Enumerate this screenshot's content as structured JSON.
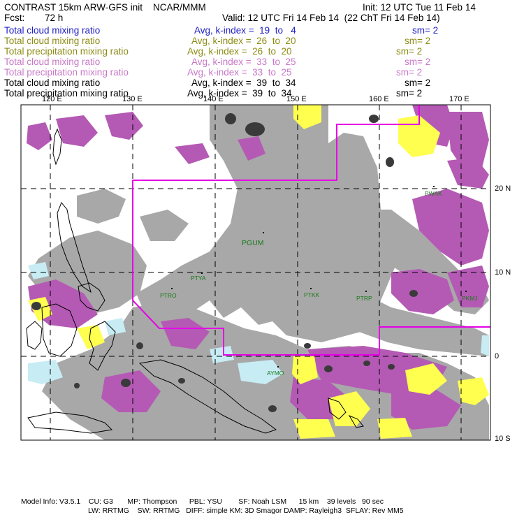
{
  "header": {
    "title": "CONTRAST 15km ARW-GFS init    NCAR/MMM",
    "init": "Init: 12 UTC Tue 11 Feb 14",
    "fcst_label": "Fcst:",
    "fcst_value": "72 h",
    "valid": "Valid: 12 UTC Fri 14 Feb 14  (22 ChT Fri 14 Feb 14)"
  },
  "legend": [
    {
      "name": "Total cloud mixing ratio",
      "avg": "Avg, k-index =  19  to   4",
      "sm": "sm= 2",
      "color": "#2020c8"
    },
    {
      "name": "Total cloud mixing ratio",
      "avg": "Avg, k-index =  26  to  20",
      "sm": "sm= 2",
      "color": "#8c8c14"
    },
    {
      "name": "Total precipitation mixing ratio",
      "avg": "Avg, k-index =  26  to  20",
      "sm": "sm= 2",
      "color": "#8c8c14"
    },
    {
      "name": "Total cloud mixing ratio",
      "avg": "Avg, k-index =  33  to  25",
      "sm": "sm= 2",
      "color": "#c878c8"
    },
    {
      "name": "Total precipitation mixing ratio",
      "avg": "Avg, k-index =  33  to  25",
      "sm": "sm= 2",
      "color": "#c878c8"
    },
    {
      "name": "Total cloud mixing ratio",
      "avg": "Avg, k-index =  39  to  34",
      "sm": "sm= 2",
      "color": "#000000"
    },
    {
      "name": "Total precipitation mixing ratio",
      "avg": "Avg, k-index =  39  to  34",
      "sm": "sm= 2",
      "color": "#000000"
    }
  ],
  "map": {
    "lon_labels": [
      "120 E",
      "130 E",
      "140 E",
      "150 E",
      "160 E",
      "170 E"
    ],
    "lat_labels": [
      "20 N",
      "10 N",
      "0",
      "10 S"
    ],
    "stations": [
      "PGUM",
      "PTYA",
      "PTRO",
      "PTKK",
      "PTRP",
      "PKMJ",
      "PWAK",
      "AYMO"
    ],
    "colors": {
      "background": "#ffffff",
      "cloud_gray": "#a8a8a8",
      "dark_core": "#3a3a3a",
      "magenta_fill": "#b45ab4",
      "yellow_fill": "#ffff50",
      "light_blue_fill": "#c8ecf4",
      "domain_box": "#e600e6",
      "grid": "#000000"
    }
  },
  "footer": {
    "line1": "Model Info: V3.5.1    CU: G3       MP: Thompson      PBL: YSU        SF: Noah LSM      15 km    39 levels   90 sec",
    "line2": "LW: RRTMG    SW: RRTMG   DIFF: simple KM: 3D Smagor DAMP: Rayleigh3  SFLAY: Rev MM5"
  }
}
